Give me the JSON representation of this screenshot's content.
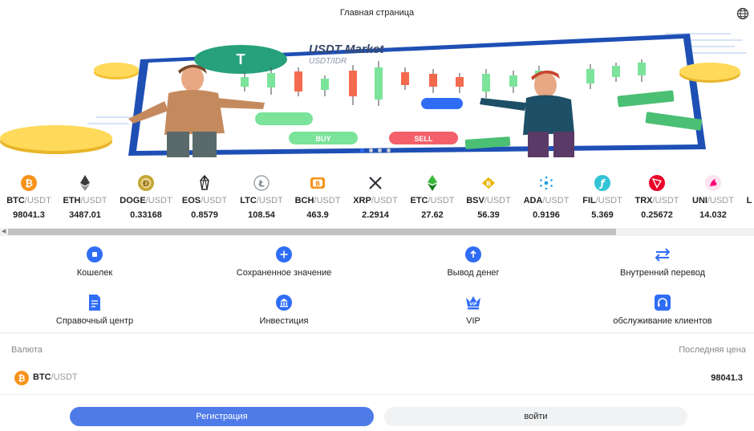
{
  "header": {
    "title": "Главная страница",
    "language_icon": "globe-icon"
  },
  "banner": {
    "title": "USDT Market",
    "subtitle": "USDT/IDR",
    "buy_label": "BUY",
    "sell_label": "SELL",
    "slide_index": 1,
    "slide_count": 4
  },
  "ticker": [
    {
      "base": "BTC",
      "quote": "/USDT",
      "price": "98041.3",
      "icon": "bitcoin-icon",
      "color": "#f7931a",
      "glyph": "₿"
    },
    {
      "base": "ETH",
      "quote": "/USDT",
      "price": "3487.01",
      "icon": "ethereum-icon",
      "color": "#3c3c3d",
      "glyph": ""
    },
    {
      "base": "DOGE",
      "quote": "/USDT",
      "price": "0.33168",
      "icon": "dogecoin-icon",
      "color": "#c2a633",
      "glyph": "Ð"
    },
    {
      "base": "EOS",
      "quote": "/USDT",
      "price": "0.8579",
      "icon": "eos-icon",
      "color": "#333333",
      "glyph": ""
    },
    {
      "base": "LTC",
      "quote": "/USDT",
      "price": "108.54",
      "icon": "litecoin-icon",
      "color": "#9aa0a6",
      "glyph": "Ł"
    },
    {
      "base": "BCH",
      "quote": "/USDT",
      "price": "463.9",
      "icon": "bitcoin-cash-icon",
      "color": "#f7931a",
      "glyph": "B"
    },
    {
      "base": "XRP",
      "quote": "/USDT",
      "price": "2.2914",
      "icon": "xrp-icon",
      "color": "#23292f",
      "glyph": "✕"
    },
    {
      "base": "ETC",
      "quote": "/USDT",
      "price": "27.62",
      "icon": "ethereum-classic-icon",
      "color": "#3ab83a",
      "glyph": ""
    },
    {
      "base": "BSV",
      "quote": "/USDT",
      "price": "56.39",
      "icon": "bitcoin-sv-icon",
      "color": "#eab300",
      "glyph": "B"
    },
    {
      "base": "ADA",
      "quote": "/USDT",
      "price": "0.9196",
      "icon": "cardano-icon",
      "color": "#0033ad",
      "glyph": "✺"
    },
    {
      "base": "FIL",
      "quote": "/USDT",
      "price": "5.369",
      "icon": "filecoin-icon",
      "color": "#0090ff",
      "glyph": "ƒ"
    },
    {
      "base": "TRX",
      "quote": "/USDT",
      "price": "0.25672",
      "icon": "tron-icon",
      "color": "#eb0029",
      "glyph": "▽"
    },
    {
      "base": "UNI",
      "quote": "/USDT",
      "price": "14.032",
      "icon": "uniswap-icon",
      "color": "#ff007a",
      "glyph": "🦄"
    },
    {
      "base": "L",
      "quote": "",
      "price": "",
      "icon": "partial-coin-icon",
      "color": "#888888",
      "glyph": ""
    }
  ],
  "actions": [
    {
      "label": "Кошелек",
      "icon": "wallet-icon",
      "name": "action-wallet"
    },
    {
      "label": "Сохраненное значение",
      "icon": "plus-icon",
      "name": "action-deposit"
    },
    {
      "label": "Вывод денег",
      "icon": "arrow-up-icon",
      "name": "action-withdraw"
    },
    {
      "label": "Внутренний перевод",
      "icon": "transfer-icon",
      "name": "action-transfer"
    },
    {
      "label": "Справочный центр",
      "icon": "document-icon",
      "name": "action-help-center"
    },
    {
      "label": "Инвестиция",
      "icon": "bank-icon",
      "name": "action-investment"
    },
    {
      "label": "VIP",
      "icon": "crown-icon",
      "name": "action-vip"
    },
    {
      "label": "обслуживание клиентов",
      "icon": "headset-icon",
      "name": "action-customer-service"
    }
  ],
  "market": {
    "currency_header": "Валюта",
    "price_header": "Последняя цена",
    "rows": [
      {
        "base": "BTC",
        "quote": "/USDT",
        "price": "98041.3",
        "icon": "bitcoin-icon"
      }
    ]
  },
  "auth": {
    "register_label": "Регистрация",
    "login_label": "войти"
  },
  "colors": {
    "accent": "#2f6df6",
    "register_button": "#4f7be8",
    "login_button": "#f1f2f4"
  }
}
